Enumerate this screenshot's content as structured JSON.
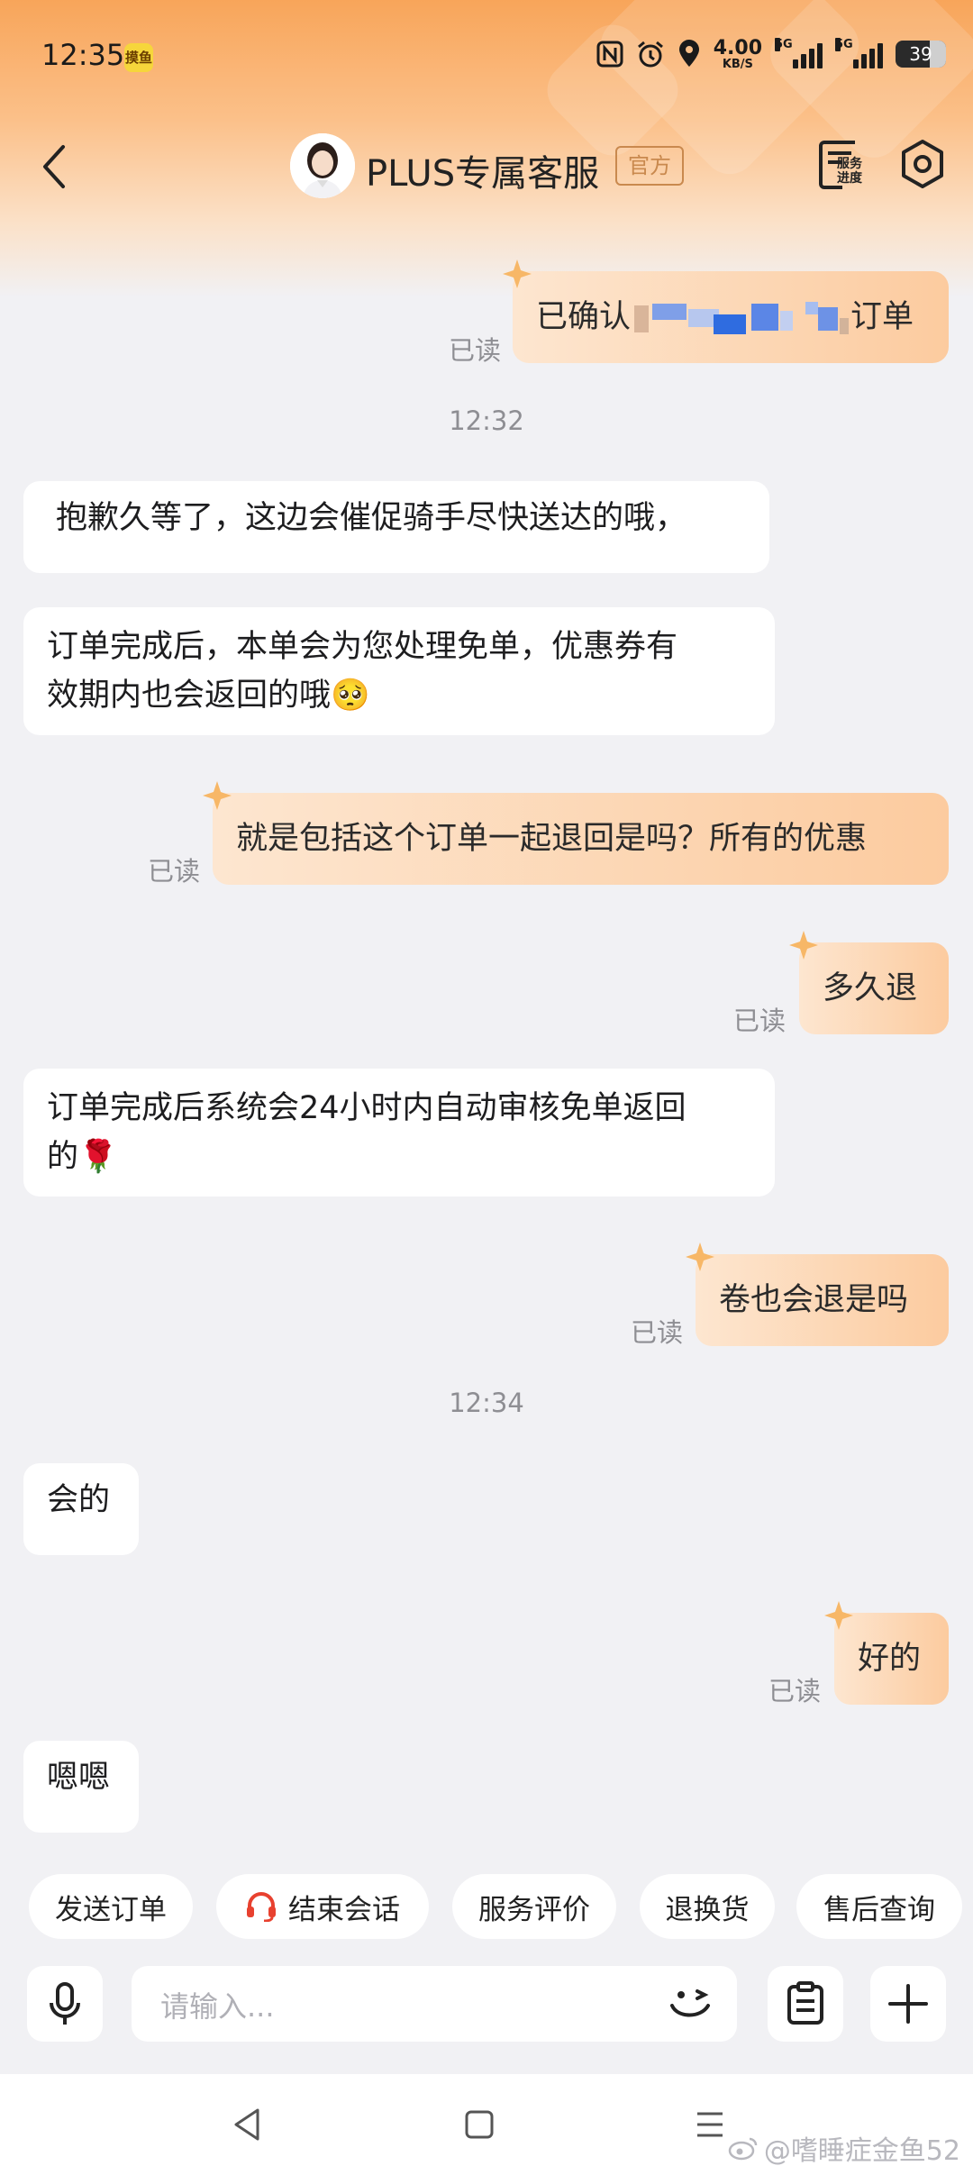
{
  "status_bar": {
    "time": "12:35",
    "app_icon_text": "摸鱼",
    "speed_value": "4.00",
    "speed_unit": "KB/S",
    "signal1_label": "5G",
    "signal2_label": "5G",
    "battery": "39",
    "icons": [
      "nfc-icon",
      "alarm-icon",
      "location-icon",
      "signal-icon",
      "battery-icon"
    ]
  },
  "header": {
    "title": "PLUS专属客服",
    "badge": "官方",
    "service_progress": [
      "服务",
      "进度"
    ]
  },
  "messages": {
    "m1": {
      "side": "right",
      "prefix": "已确认",
      "suffix": "订单",
      "read": "已读"
    },
    "t1": "12:32",
    "m2": {
      "side": "left",
      "text": "抱歉久等了，这边会催促骑手尽快送达的哦，"
    },
    "m3": {
      "side": "left",
      "line1": "订单完成后，本单会为您处理免单，优惠券有",
      "line2": "效期内也会返回的哦",
      "emoji": "🥺"
    },
    "m4": {
      "side": "right",
      "text": "就是包括这个订单一起退回是吗？所有的优惠",
      "read": "已读"
    },
    "m5": {
      "side": "right",
      "text": "多久退",
      "read": "已读"
    },
    "m6": {
      "side": "left",
      "line1": "订单完成后系统会24小时内自动审核免单返回",
      "line2": "的",
      "emoji": "🌹"
    },
    "m7": {
      "side": "right",
      "text": "卷也会退是吗",
      "read": "已读"
    },
    "t2": "12:34",
    "m8": {
      "side": "left",
      "text": "会的"
    },
    "m9": {
      "side": "right",
      "text": "好的",
      "read": "已读"
    },
    "m10": {
      "side": "left",
      "text": "嗯嗯"
    }
  },
  "quick_actions": [
    "发送订单",
    "结束会话",
    "服务评价",
    "退换货",
    "售后查询"
  ],
  "input": {
    "placeholder": "请输入..."
  },
  "watermark": "@嗜睡症金鱼52",
  "colors": {
    "accent": "#f8a55a",
    "bubble_right_start": "#fde6d0",
    "bubble_right_end": "#fccb9f",
    "headset_red": "#e8412f"
  }
}
